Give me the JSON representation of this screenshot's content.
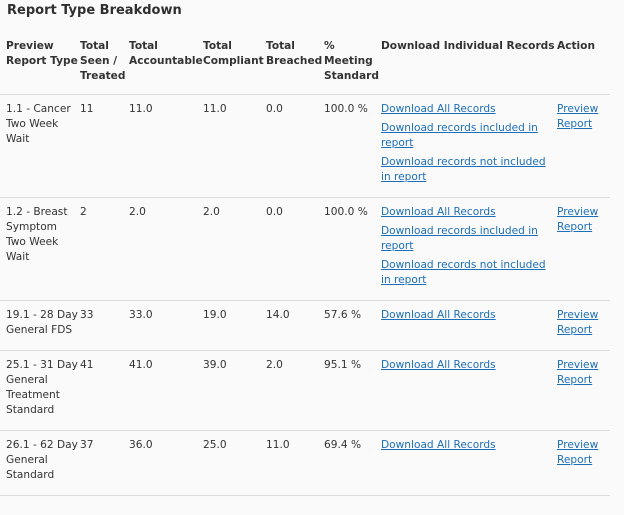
{
  "title": "Report Type Breakdown",
  "columns": {
    "report_type": "Preview Report Type",
    "seen": "Total Seen / Treated",
    "accountable": "Total Accountable",
    "compliant": "Total Compliant",
    "breached": "Total Breached",
    "meeting": "% Meeting Standard",
    "download": "Download Individual Records",
    "action": "Action"
  },
  "links": {
    "all": "Download All Records",
    "included": "Download records included in report",
    "not_included": "Download records not included in report",
    "preview": "Preview Report"
  },
  "rows": [
    {
      "report_type": "1.1 - Cancer Two Week Wait",
      "seen": "11",
      "accountable": "11.0",
      "compliant": "11.0",
      "breached": "0.0",
      "meeting": "100.0 %"
    },
    {
      "report_type": "1.2 - Breast Symptom Two Week Wait",
      "seen": "2",
      "accountable": "2.0",
      "compliant": "2.0",
      "breached": "0.0",
      "meeting": "100.0 %"
    },
    {
      "report_type": "19.1 - 28 Day General FDS",
      "seen": "33",
      "accountable": "33.0",
      "compliant": "19.0",
      "breached": "14.0",
      "meeting": "57.6 %"
    },
    {
      "report_type": "25.1 - 31 Day General Treatment Standard",
      "seen": "41",
      "accountable": "41.0",
      "compliant": "39.0",
      "breached": "2.0",
      "meeting": "95.1 %"
    },
    {
      "report_type": "26.1 - 62 Day General Standard",
      "seen": "37",
      "accountable": "36.0",
      "compliant": "25.0",
      "breached": "11.0",
      "meeting": "69.4 %"
    }
  ]
}
